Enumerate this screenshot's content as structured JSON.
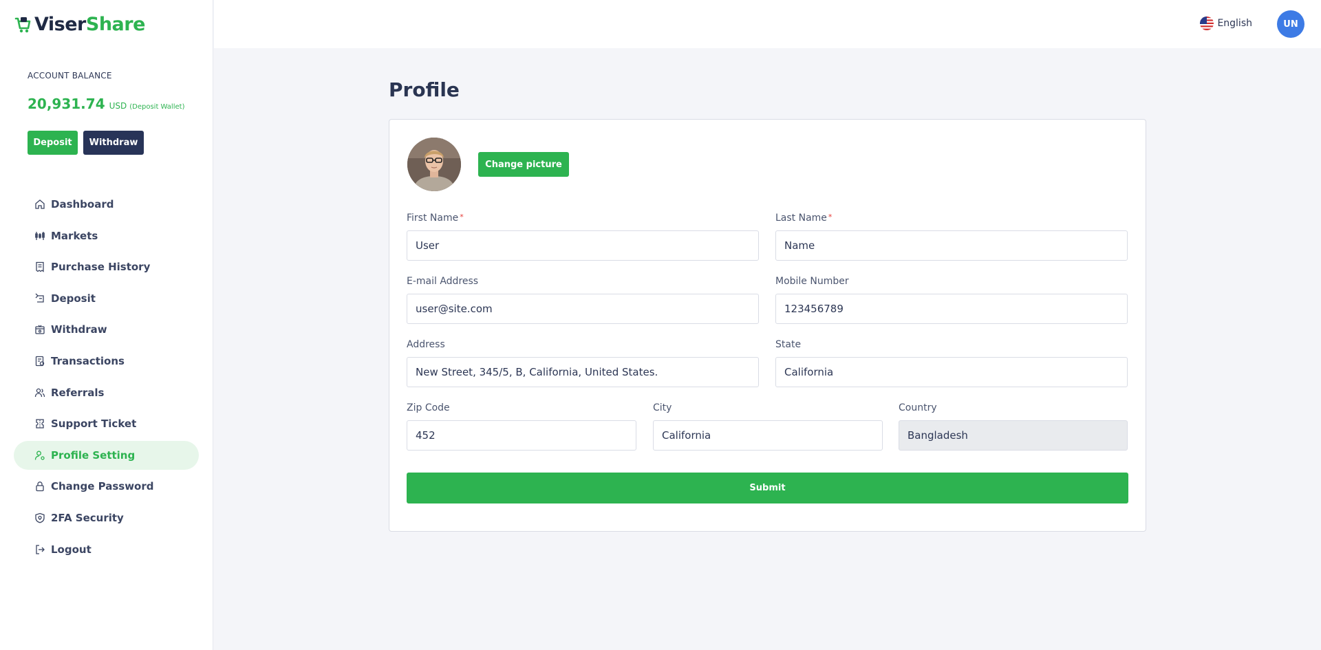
{
  "brand": {
    "name_part1": "Viser",
    "name_part2": "Share"
  },
  "sidebar": {
    "balance_label": "ACCOUNT BALANCE",
    "balance_amount": "20,931.74",
    "balance_currency": "USD",
    "balance_wallet": "(Deposit Wallet)",
    "deposit_label": "Deposit",
    "withdraw_label": "Withdraw",
    "items": [
      {
        "label": "Dashboard",
        "icon": "home-icon"
      },
      {
        "label": "Markets",
        "icon": "chart-icon"
      },
      {
        "label": "Purchase History",
        "icon": "receipt-icon"
      },
      {
        "label": "Deposit",
        "icon": "deposit-icon"
      },
      {
        "label": "Withdraw",
        "icon": "withdraw-icon"
      },
      {
        "label": "Transactions",
        "icon": "transactions-icon"
      },
      {
        "label": "Referrals",
        "icon": "users-icon"
      },
      {
        "label": "Support Ticket",
        "icon": "ticket-icon"
      },
      {
        "label": "Profile Setting",
        "icon": "user-gear-icon",
        "active": true
      },
      {
        "label": "Change Password",
        "icon": "lock-icon"
      },
      {
        "label": "2FA Security",
        "icon": "shield-icon"
      },
      {
        "label": "Logout",
        "icon": "logout-icon"
      }
    ]
  },
  "topbar": {
    "language": "English",
    "user_initials": "UN"
  },
  "page": {
    "title": "Profile"
  },
  "form": {
    "change_picture_label": "Change picture",
    "first_name": {
      "label": "First Name",
      "required_mark": "*",
      "value": "User"
    },
    "last_name": {
      "label": "Last Name",
      "required_mark": "*",
      "value": "Name"
    },
    "email": {
      "label": "E-mail Address",
      "value": "user@site.com"
    },
    "mobile": {
      "label": "Mobile Number",
      "value": "123456789"
    },
    "address": {
      "label": "Address",
      "value": "New Street, 345/5, B, California, United States."
    },
    "state": {
      "label": "State",
      "value": "California"
    },
    "zip": {
      "label": "Zip Code",
      "value": "452"
    },
    "city": {
      "label": "City",
      "value": "California"
    },
    "country": {
      "label": "Country",
      "value": "Bangladesh"
    },
    "submit_label": "Submit"
  },
  "colors": {
    "accent": "#2db350",
    "navy": "#283458",
    "avatar": "#3d7be5",
    "background": "#f4f5f9"
  }
}
